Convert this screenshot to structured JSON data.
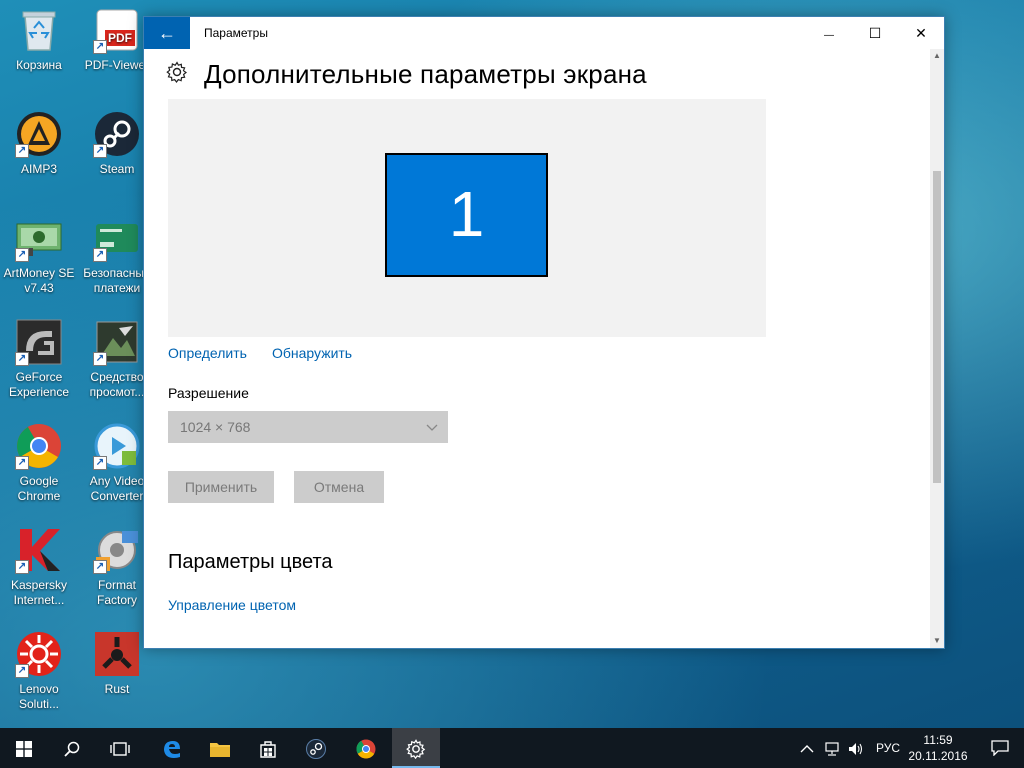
{
  "desktop": {
    "icons": [
      {
        "label": "Корзина",
        "icon": "recycle-bin-icon"
      },
      {
        "label": "PDF-Viewer",
        "icon": "pdf-icon",
        "badge": "PDF"
      },
      {
        "label": "AIMP3",
        "icon": "aimp-icon"
      },
      {
        "label": "Steam",
        "icon": "steam-icon"
      },
      {
        "label": "ArtMoney SE\nv7.43",
        "icon": "artmoney-icon"
      },
      {
        "label": "Безопасные\nплатежи",
        "icon": "safe-payments-icon"
      },
      {
        "label": "GeForce\nExperience",
        "icon": "geforce-icon"
      },
      {
        "label": "Средство\nпросмот...",
        "icon": "viewer-icon"
      },
      {
        "label": "Google\nChrome",
        "icon": "chrome-icon"
      },
      {
        "label": "Any Video\nConverter",
        "icon": "video-converter-icon"
      },
      {
        "label": "Kaspersky\nInternet...",
        "icon": "kaspersky-icon"
      },
      {
        "label": "Format\nFactory",
        "icon": "format-factory-icon"
      },
      {
        "label": "Lenovo\nSoluti...",
        "icon": "lenovo-icon"
      },
      {
        "label": "Rust",
        "icon": "rust-icon"
      }
    ]
  },
  "window": {
    "title": "Параметры",
    "back_glyph": "←",
    "minimize_glyph": "—",
    "maximize_glyph": "☐",
    "close_glyph": "✕"
  },
  "page": {
    "title": "Дополнительные параметры экрана",
    "monitor_number": "1",
    "identify_link": "Определить",
    "detect_link": "Обнаружить",
    "resolution_label": "Разрешение",
    "resolution_value": "1024 × 768",
    "apply_button": "Применить",
    "cancel_button": "Отмена",
    "color_section_title": "Параметры цвета",
    "color_management_link": "Управление цветом"
  },
  "taskbar": {
    "language": "РУС",
    "time": "11:59",
    "date": "20.11.2016"
  },
  "colors": {
    "accent": "#0078d7",
    "back_button": "#0063b1",
    "link": "#0063b1",
    "taskbar": "#101820"
  }
}
